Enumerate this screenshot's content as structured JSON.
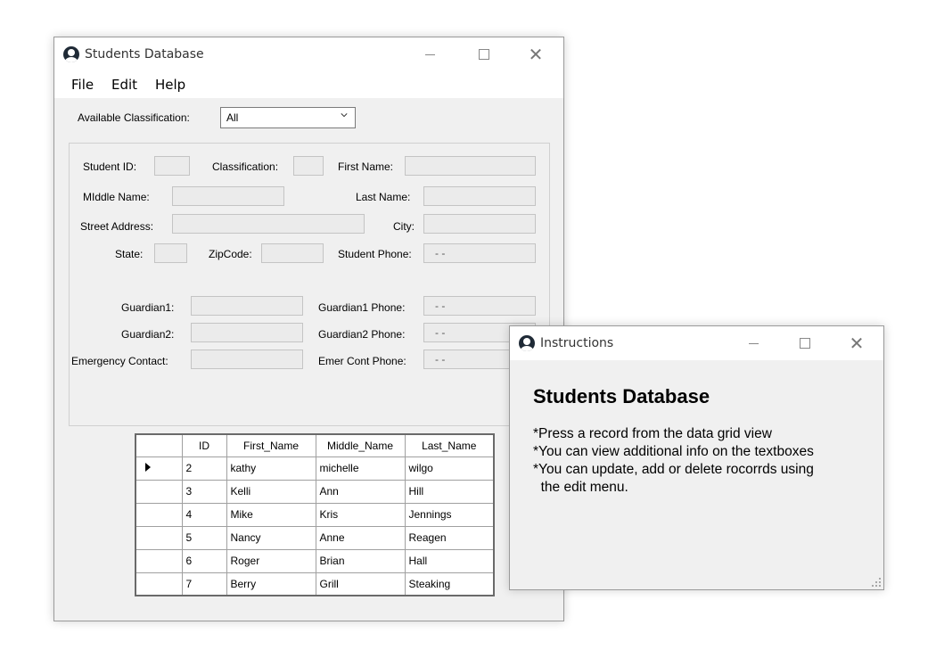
{
  "main_window": {
    "title": "Students Database",
    "menu": [
      "File",
      "Edit",
      "Help"
    ],
    "classification_label": "Available Classification:",
    "classification_value": "All",
    "fields": {
      "student_id": {
        "label": "Student ID:",
        "value": ""
      },
      "classification": {
        "label": "Classification:",
        "value": ""
      },
      "first_name": {
        "label": "First Name:",
        "value": ""
      },
      "middle_name": {
        "label": "MIddle Name:",
        "value": ""
      },
      "last_name": {
        "label": "Last Name:",
        "value": ""
      },
      "street_address": {
        "label": "Street Address:",
        "value": ""
      },
      "city": {
        "label": "City:",
        "value": ""
      },
      "state": {
        "label": "State:",
        "value": ""
      },
      "zipcode": {
        "label": "ZipCode:",
        "value": ""
      },
      "student_phone": {
        "label": "Student Phone:",
        "value": " -  -"
      },
      "guardian1": {
        "label": "Guardian1:",
        "value": ""
      },
      "guardian1_phone": {
        "label": "Guardian1 Phone:",
        "value": " -  -"
      },
      "guardian2": {
        "label": "Guardian2:",
        "value": ""
      },
      "guardian2_phone": {
        "label": "Guardian2 Phone:",
        "value": " -  -"
      },
      "emergency_contact": {
        "label": "Emergency Contact:",
        "value": ""
      },
      "emer_cont_phone": {
        "label": "Emer Cont Phone:",
        "value": " -  -"
      }
    },
    "grid": {
      "columns": [
        "ID",
        "First_Name",
        "Middle_Name",
        "Last_Name"
      ],
      "rows": [
        [
          "2",
          "kathy",
          "michelle",
          "wilgo"
        ],
        [
          "3",
          "Kelli",
          "Ann",
          "Hill"
        ],
        [
          "4",
          "Mike",
          "Kris",
          "Jennings"
        ],
        [
          "5",
          "Nancy",
          "Anne",
          "Reagen"
        ],
        [
          "6",
          "Roger",
          "Brian",
          "Hall"
        ],
        [
          "7",
          "Berry",
          "Grill",
          "Steaking"
        ]
      ]
    }
  },
  "instructions_window": {
    "title": "Instructions",
    "heading": "Students Database",
    "lines": [
      "*Press a record from the data grid view",
      "*You can view additional info on the textboxes",
      "*You can update, add or delete rocorrds using",
      "  the edit menu."
    ]
  }
}
